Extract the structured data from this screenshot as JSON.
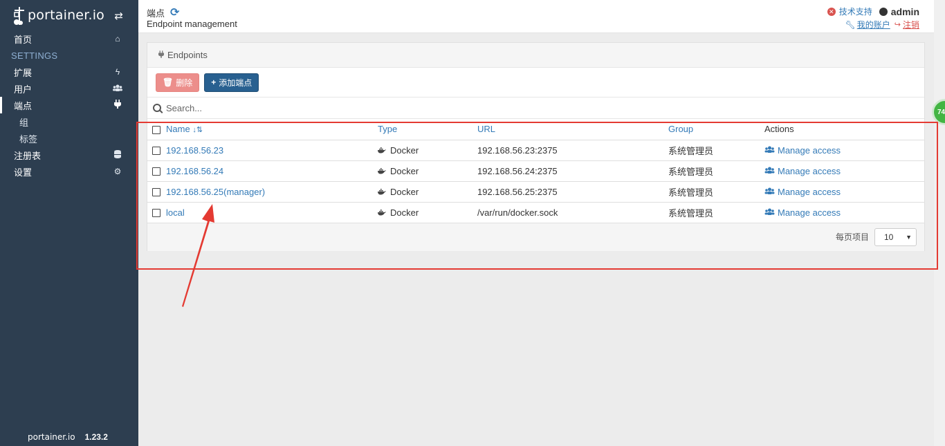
{
  "sidebar": {
    "brand": "portainer.io",
    "nav": [
      {
        "label": "首页",
        "icon": "home-icon"
      },
      {
        "label": "扩展",
        "icon": "bolt-icon"
      },
      {
        "label": "用户",
        "icon": "users-icon"
      },
      {
        "label": "端点",
        "icon": "plug-icon",
        "active": true
      }
    ],
    "settings_heading": "SETTINGS",
    "sub_items": [
      "组",
      "标签"
    ],
    "nav2": [
      {
        "label": "注册表",
        "icon": "database-icon"
      },
      {
        "label": "设置",
        "icon": "cogs-icon"
      }
    ],
    "footer_logo": "portainer.io",
    "version": "1.23.2"
  },
  "header": {
    "title": "端点",
    "subtitle": "Endpoint management",
    "support": "技术支持",
    "username": "admin",
    "my_account": "我的账户",
    "logout": "注销"
  },
  "panel": {
    "title": "Endpoints",
    "delete_label": "删除",
    "add_label": "添加端点",
    "search_placeholder": "Search...",
    "columns": {
      "name": "Name",
      "type": "Type",
      "url": "URL",
      "group": "Group",
      "actions": "Actions"
    },
    "rows": [
      {
        "name": "192.168.56.23",
        "type": "Docker",
        "url": "192.168.56.23:2375",
        "group": "系统管理员",
        "action": "Manage access"
      },
      {
        "name": "192.168.56.24",
        "type": "Docker",
        "url": "192.168.56.24:2375",
        "group": "系统管理员",
        "action": "Manage access"
      },
      {
        "name": "192.168.56.25(manager)",
        "type": "Docker",
        "url": "192.168.56.25:2375",
        "group": "系统管理员",
        "action": "Manage access"
      },
      {
        "name": "local",
        "type": "Docker",
        "url": "/var/run/docker.sock",
        "group": "系统管理员",
        "action": "Manage access"
      }
    ],
    "per_page_label": "每页项目",
    "per_page_value": "10"
  },
  "badge": "74",
  "colors": {
    "sidebar": "#2d3e50",
    "link": "#337ab7",
    "annotation": "#e43a32",
    "primary": "#286090",
    "danger": "#ec8e8b"
  }
}
